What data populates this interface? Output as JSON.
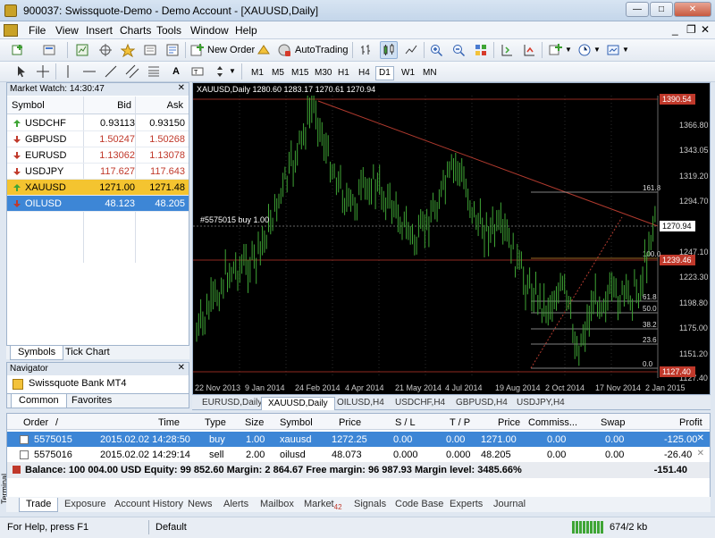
{
  "window": {
    "title": "900037: Swissquote-Demo - Demo Account - [XAUUSD,Daily]",
    "min": "—",
    "max": "□",
    "close": "✕"
  },
  "menu": [
    "File",
    "View",
    "Insert",
    "Charts",
    "Tools",
    "Window",
    "Help"
  ],
  "toolbar": {
    "new_order": "New Order",
    "autotrading": "AutoTrading"
  },
  "timeframes": [
    "M1",
    "M5",
    "M15",
    "M30",
    "H1",
    "H4",
    "D1",
    "W1",
    "MN"
  ],
  "timeframe_active": "D1",
  "market_watch": {
    "title": "Market Watch: 14:30:47",
    "columns": {
      "symbol": "Symbol",
      "bid": "Bid",
      "ask": "Ask"
    },
    "rows": [
      {
        "symbol": "USDCHF",
        "bid": "0.93113",
        "ask": "0.93150",
        "dir": "up"
      },
      {
        "symbol": "GBPUSD",
        "bid": "1.50247",
        "ask": "1.50268",
        "dir": "down"
      },
      {
        "symbol": "EURUSD",
        "bid": "1.13062",
        "ask": "1.13078",
        "dir": "down"
      },
      {
        "symbol": "USDJPY",
        "bid": "117.627",
        "ask": "117.643",
        "dir": "down"
      },
      {
        "symbol": "XAUUSD",
        "bid": "1271.00",
        "ask": "1271.48",
        "dir": "up"
      },
      {
        "symbol": "OILUSD",
        "bid": "48.123",
        "ask": "48.205",
        "dir": "down"
      }
    ],
    "selected_rows": {
      "XAUUSD": "#f4c430",
      "OILUSD": "#3d86d6"
    },
    "tabs": [
      "Symbols",
      "Tick Chart"
    ]
  },
  "navigator": {
    "title": "Navigator",
    "item": "Swissquote Bank MT4",
    "tabs": [
      "Common",
      "Favorites"
    ]
  },
  "chart": {
    "header": "XAUUSD,Daily  1280.60 1283.17 1270.61 1270.94",
    "order_label": "#5575015 buy 1.00",
    "price_labels": [
      "1366.80",
      "1343.05",
      "1319.20",
      "1294.70",
      "1247.10",
      "1223.30",
      "1198.80",
      "1175.00",
      "1151.20",
      "1127.40"
    ],
    "highlight_prices": [
      {
        "text": "1390.54",
        "color": "#c0392b"
      },
      {
        "text": "1270.94",
        "color": "#ffffff"
      },
      {
        "text": "1239.46",
        "color": "#c0392b"
      },
      {
        "text": "1127.40",
        "color": "#c0392b"
      }
    ],
    "fib_labels": [
      "161.8",
      "100.0",
      "61.8",
      "50.0",
      "38.2",
      "23.6",
      "0.0"
    ],
    "date_labels": [
      "22 Nov 2013",
      "9 Jan 2014",
      "24 Feb 2014",
      "4 Apr 2014",
      "21 May 2014",
      "4 Jul 2014",
      "19 Aug 2014",
      "2 Oct 2014",
      "17 Nov 2014",
      "2 Jan 2015"
    ],
    "tabs": [
      "EURUSD,Daily",
      "XAUUSD,Daily",
      "OILUSD,H4",
      "USDCHF,H4",
      "GBPUSD,H4",
      "USDJPY,H4"
    ],
    "active_tab": "XAUUSD,Daily",
    "candle_color": "#3fa535"
  },
  "terminal": {
    "headers": [
      "Order",
      "/",
      "Time",
      "Type",
      "Size",
      "Symbol",
      "Price",
      "S / L",
      "T / P",
      "Price",
      "Commiss...",
      "Swap",
      "Profit"
    ],
    "orders": [
      {
        "order": "5575015",
        "time": "2015.02.02 14:28:50",
        "type": "buy",
        "size": "1.00",
        "symbol": "xauusd",
        "price": "1272.25",
        "sl": "0.00",
        "tp": "0.00",
        "cur": "1271.00",
        "comm": "0.00",
        "swap": "0.00",
        "profit": "-125.00"
      },
      {
        "order": "5575016",
        "time": "2015.02.02 14:29:14",
        "type": "sell",
        "size": "2.00",
        "symbol": "oilusd",
        "price": "48.073",
        "sl": "0.000",
        "tp": "0.000",
        "cur": "48.205",
        "comm": "0.00",
        "swap": "0.00",
        "profit": "-26.40"
      }
    ],
    "balance_text": "Balance: 100 004.00 USD  Equity: 99 852.60  Margin: 2 864.67  Free margin: 96 987.93  Margin level: 3485.66%",
    "balance_profit": "-151.40",
    "tabs": [
      "Trade",
      "Exposure",
      "Account History",
      "News",
      "Alerts",
      "Mailbox",
      "Market",
      "Signals",
      "Code Base",
      "Experts",
      "Journal"
    ],
    "market_badge": "42",
    "side_label": "Terminal"
  },
  "status": {
    "help": "For Help, press F1",
    "profile": "Default",
    "traffic": "674/2 kb"
  }
}
